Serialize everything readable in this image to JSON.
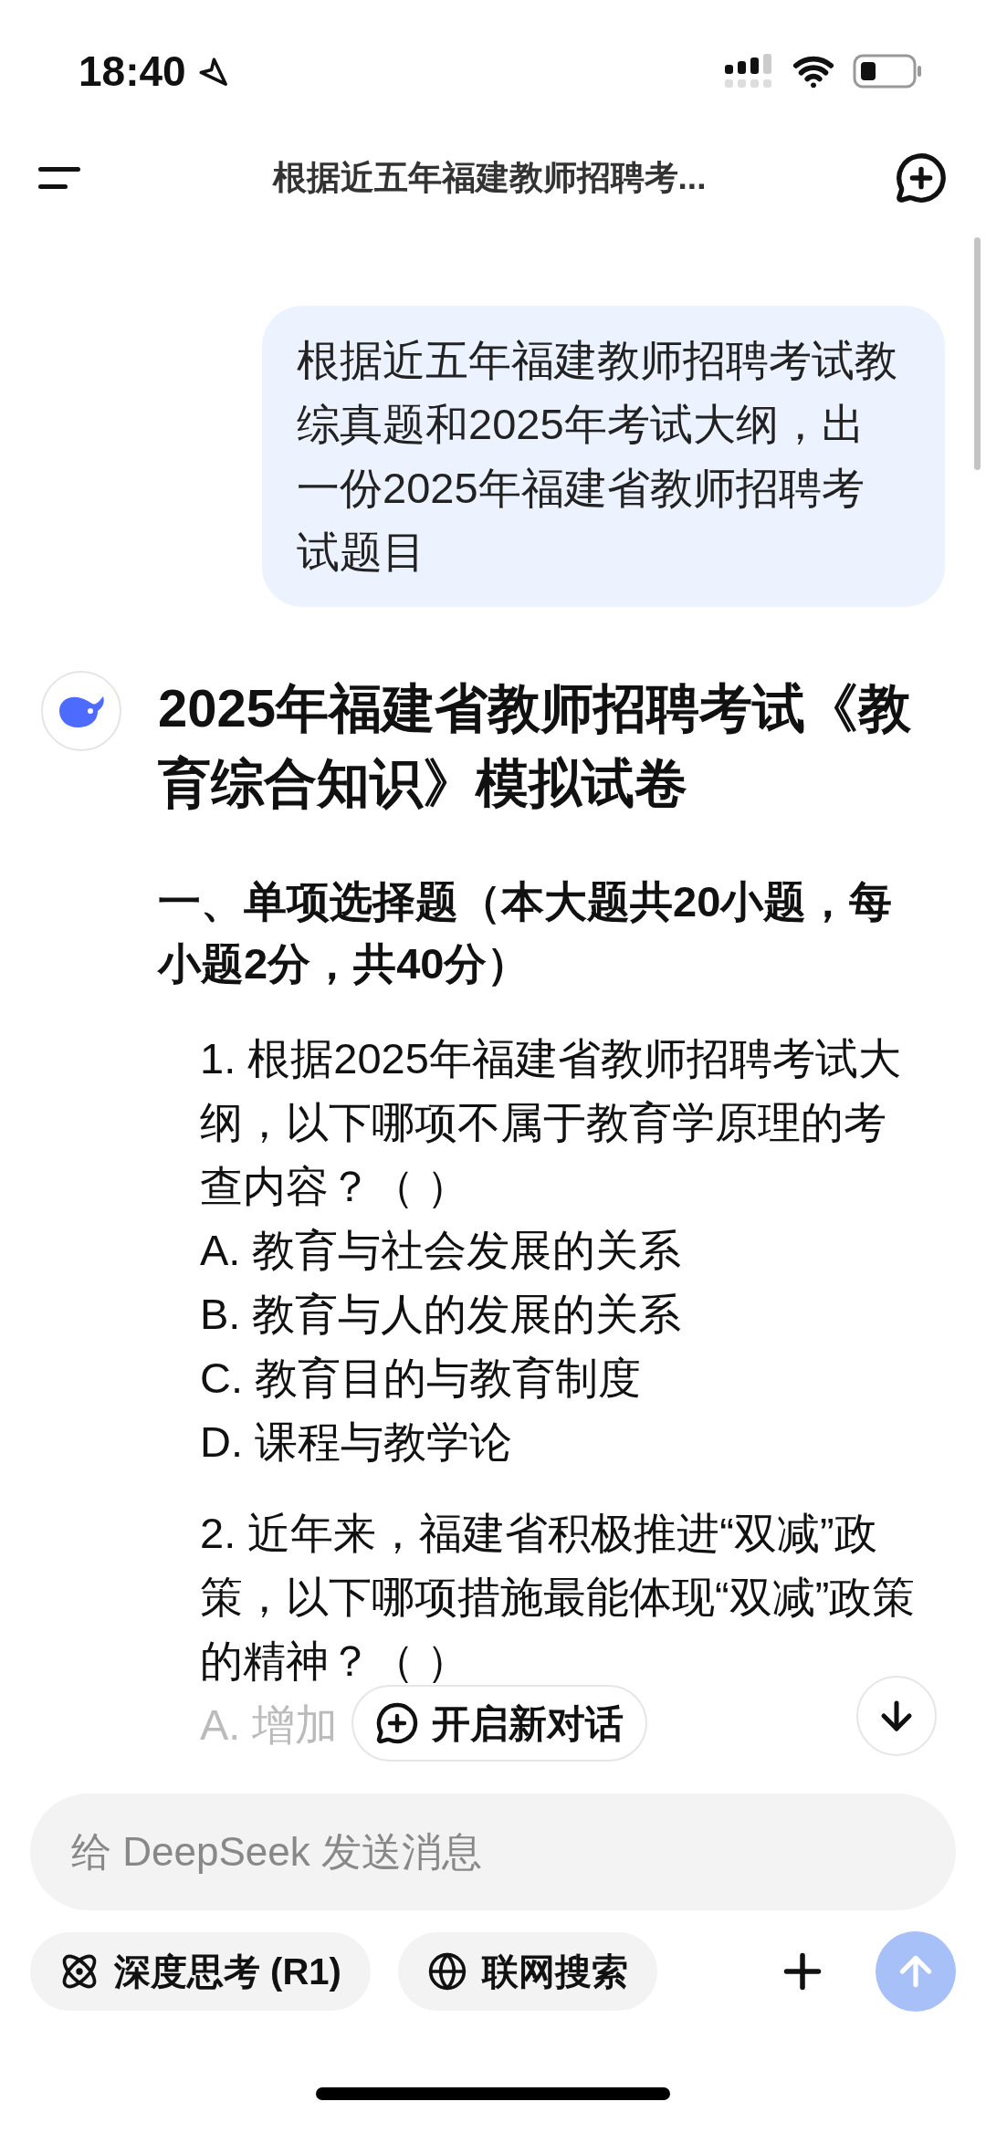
{
  "status_bar": {
    "time": "18:40"
  },
  "header": {
    "title": "根据近五年福建教师招聘考..."
  },
  "user_message": "根据近五年福建教师招聘考试教综真题和2025年考试大纲，出一份2025年福建省教师招聘考试题目",
  "reply": {
    "title": "2025年福建省教师招聘考试《教育综合知识》模拟试卷",
    "section": "一、单项选择题（本大题共20小题，每小题2分，共40分）",
    "questions": [
      {
        "number": "1.",
        "text": "根据2025年福建省教师招聘考试大纲，以下哪项不属于教育学原理的考查内容？（ ）",
        "options": [
          {
            "text": "A. 教育与社会发展的关系",
            "faded": false
          },
          {
            "text": "B. 教育与人的发展的关系",
            "faded": false
          },
          {
            "text": "C. 教育目的与教育制度",
            "faded": false
          },
          {
            "text": "D. 课程与教学论",
            "faded": false
          }
        ]
      },
      {
        "number": "2.",
        "text": "近年来，福建省积极推进“双减”政策，以下哪项措施最能体现“双减”政策的精神？（ ）",
        "options": [
          {
            "text": "A. 增加",
            "faded": true
          }
        ]
      }
    ]
  },
  "floating": {
    "new_chat": "开启新对话"
  },
  "composer": {
    "placeholder": "给 DeepSeek 发送消息",
    "toggles": [
      {
        "kind": "think",
        "label": "深度思考 (R1)",
        "selected": false
      },
      {
        "kind": "search",
        "label": "联网搜索",
        "selected": false
      }
    ],
    "send_enabled": false
  }
}
